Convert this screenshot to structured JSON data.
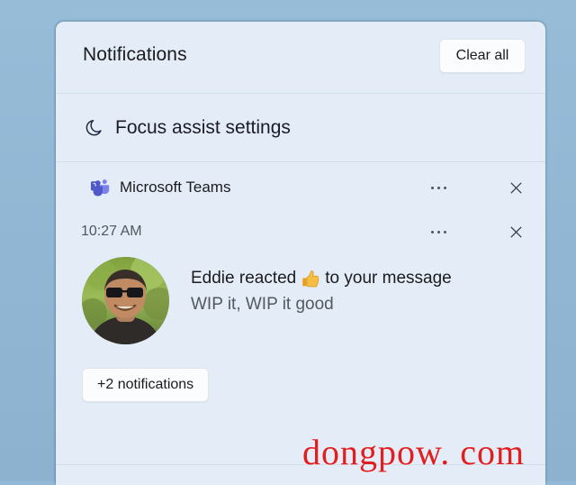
{
  "desktop": {
    "background_color": "#93b9d6"
  },
  "panel": {
    "background_color": "#e4edf7",
    "header": {
      "title": "Notifications",
      "clear_all_label": "Clear all"
    },
    "focus_assist": {
      "icon": "moon-icon",
      "label": "Focus assist settings"
    },
    "notification_group": {
      "app_icon": "microsoft-teams-icon",
      "app_name": "Microsoft Teams",
      "group_more_icon": "ellipsis-icon",
      "group_close_icon": "close-icon",
      "notification": {
        "time": "10:27 AM",
        "more_icon": "ellipsis-icon",
        "close_icon": "close-icon",
        "avatar": "user-avatar-photo",
        "title_before": "Eddie reacted",
        "reaction_emoji": "thumbs-up-emoji",
        "title_after": "to your message",
        "subtitle": "WIP it, WIP it good"
      },
      "more_notifications_label": "+2 notifications"
    }
  },
  "watermark": {
    "text": "dongpow. com",
    "color": "#e02020"
  }
}
